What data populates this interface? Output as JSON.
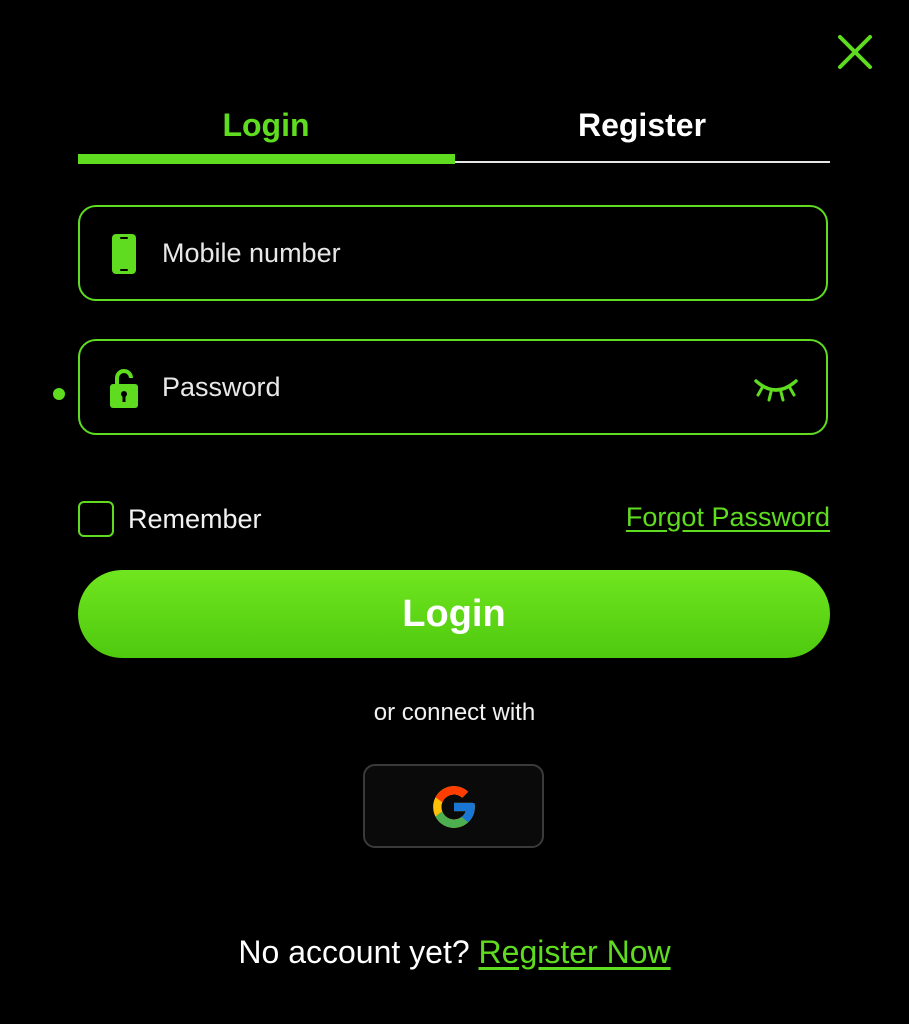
{
  "colors": {
    "accent": "#5fdc1f",
    "background": "#000000",
    "text": "#ffffff"
  },
  "header": {
    "close_icon": "close-icon"
  },
  "tabs": [
    {
      "label": "Login",
      "active": true
    },
    {
      "label": "Register",
      "active": false
    }
  ],
  "form": {
    "mobile": {
      "placeholder": "Mobile number",
      "value": "",
      "icon": "phone-icon"
    },
    "password": {
      "placeholder": "Password",
      "value": "",
      "icon": "lock-icon",
      "toggle_icon": "eye-closed-icon"
    },
    "remember_label": "Remember",
    "remember_checked": false,
    "forgot_label": "Forgot Password",
    "submit_label": "Login"
  },
  "social": {
    "label": "or connect with",
    "providers": [
      {
        "name": "google",
        "icon": "google-icon"
      }
    ]
  },
  "footer": {
    "text": "No account yet?",
    "link_label": "Register Now"
  }
}
